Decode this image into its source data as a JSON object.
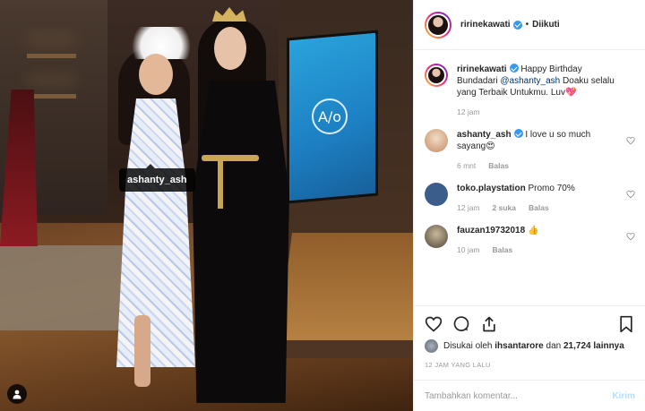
{
  "header": {
    "username": "ririnekawati",
    "separator": "•",
    "follow_status": "Diikuti"
  },
  "photo": {
    "tag_label": "ashanty_ash",
    "tv_logo_text": "A/o"
  },
  "caption": {
    "username": "ririnekawati",
    "text_before": "Happy Birthday Bundadari ",
    "mention": "@ashanty_ash",
    "text_after": "Doaku selalu yang Terbaik Untukmu. Luv",
    "emoji": "💖",
    "time": "12 jam"
  },
  "comments": [
    {
      "username": "ashanty_ash",
      "verified": true,
      "text": "I love u so much sayang",
      "emoji": "😍",
      "time": "6 mnt",
      "likes": "",
      "reply": "Balas"
    },
    {
      "username": "toko.playstation",
      "verified": false,
      "text": "Promo 70%",
      "emoji": "",
      "time": "12 jam",
      "likes": "2 suka",
      "reply": "Balas"
    },
    {
      "username": "fauzan19732018",
      "verified": false,
      "text": "",
      "emoji": "👍",
      "time": "10 jam",
      "likes": "",
      "reply": "Balas"
    }
  ],
  "partial_comment": "…",
  "likes": {
    "prefix": "Disukai oleh ",
    "user": "ihsantarore",
    "middle": " dan ",
    "count": "21,724 lainnya"
  },
  "post_time": "12 JAM YANG LALU",
  "add_comment": {
    "placeholder": "Tambahkan komentar...",
    "send_label": "Kirim"
  },
  "colors": {
    "verified": "#3897f0",
    "send_disabled": "#b2dffc",
    "meta": "#999999"
  }
}
